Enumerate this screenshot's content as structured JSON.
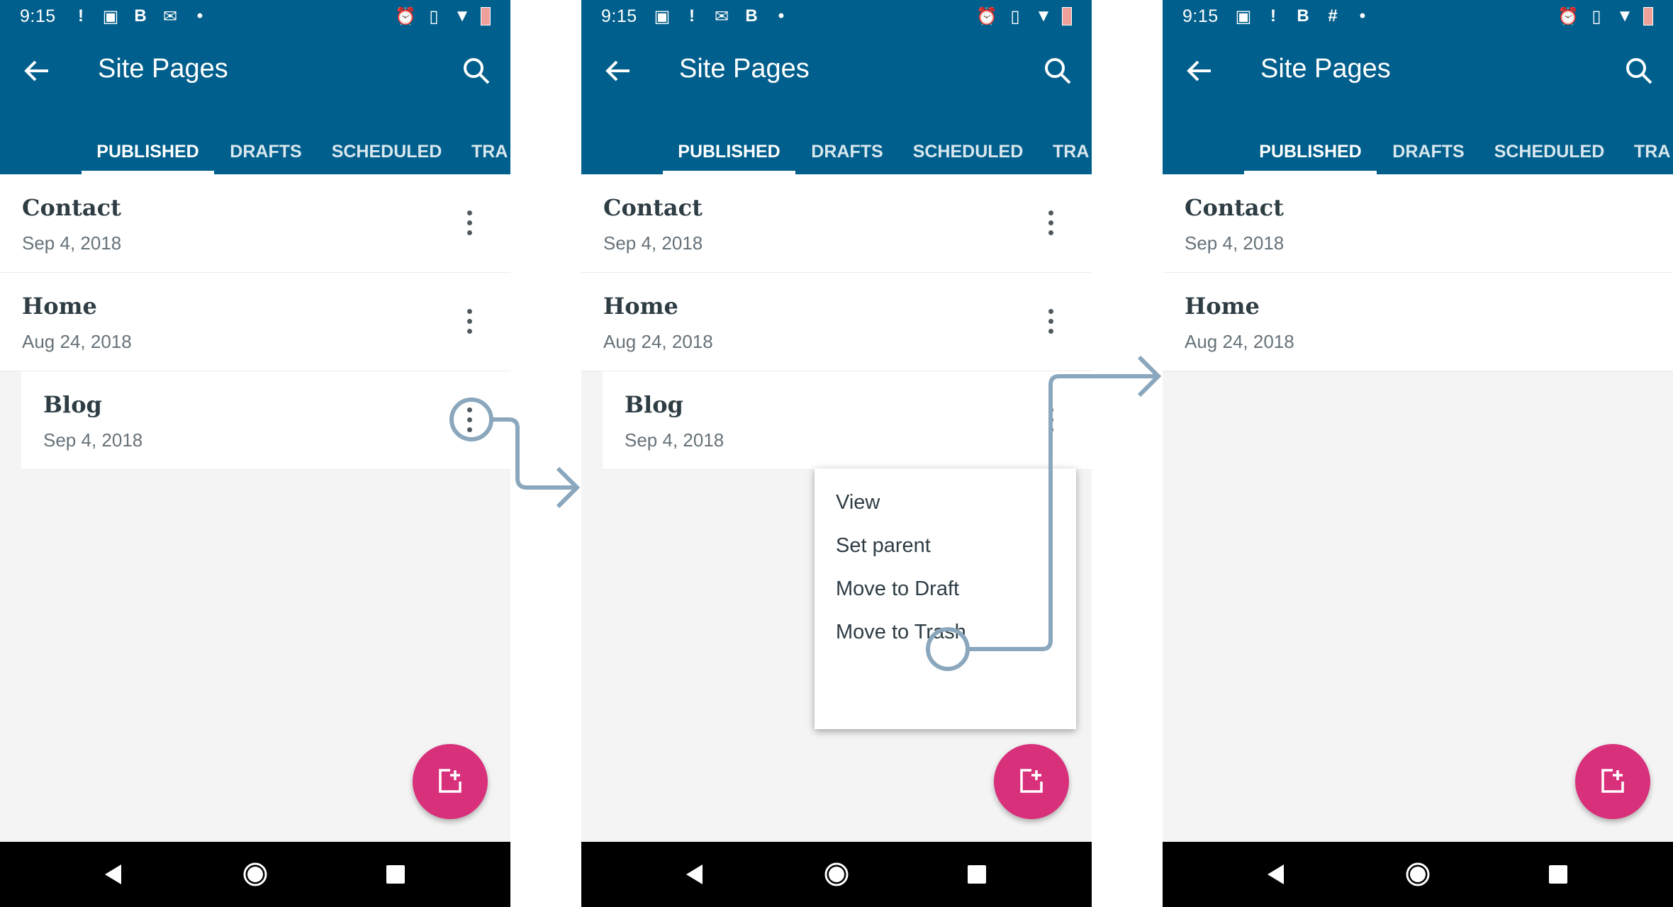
{
  "status": {
    "time": "9:15"
  },
  "appbar": {
    "title": "Site Pages"
  },
  "tabs": [
    "PUBLISHED",
    "DRAFTS",
    "SCHEDULED",
    "TRA"
  ],
  "pages": [
    {
      "title": "Contact",
      "date": "Sep 4, 2018"
    },
    {
      "title": "Home",
      "date": "Aug 24, 2018"
    },
    {
      "title": "Blog",
      "date": "Sep 4, 2018"
    }
  ],
  "menu": {
    "items": [
      "View",
      "Set parent",
      "Move to Draft",
      "Move to Trash"
    ]
  },
  "colors": {
    "primary": "#005f8c",
    "fab": "#d8307b",
    "annotation": "#8aa7bd"
  }
}
